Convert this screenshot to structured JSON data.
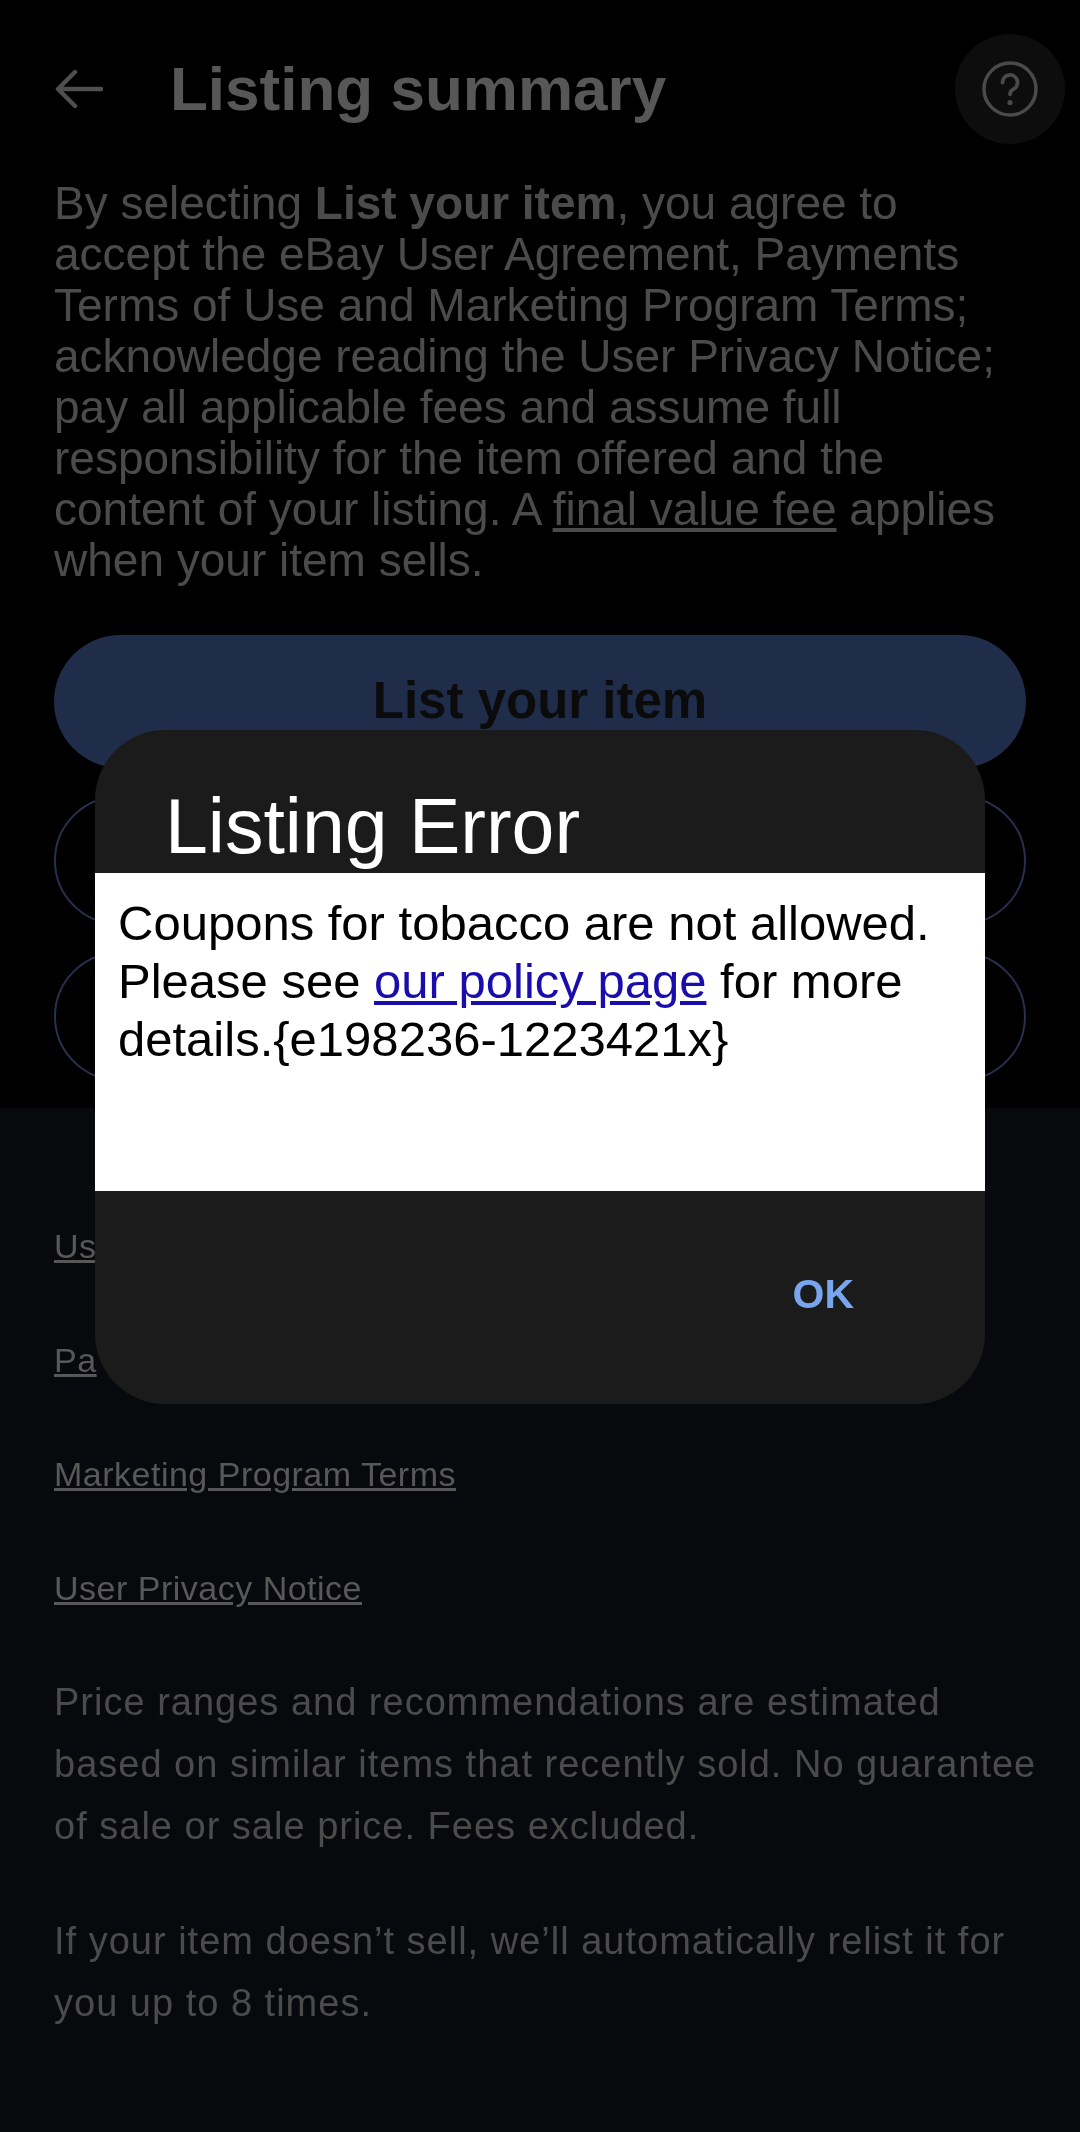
{
  "header": {
    "title": "Listing summary"
  },
  "agreement": {
    "text_before": "By selecting **List your item**, you agree to accept the eBay User Agreement, Payments Terms of Use and Marketing Program Terms; acknowledge reading the User Privacy Notice; pay all applicable fees and assume full responsibility for the item offered and the content of your listing. A",
    "link": "final value fee",
    "text_after": "applies when your item sells."
  },
  "primary_button": {
    "label": "List your item"
  },
  "legal_links": [
    "Us",
    "Pa",
    "Marketing Program Terms",
    "User Privacy Notice"
  ],
  "notes": [
    "Price ranges and recommendations are estimated based on similar items that recently sold. No guarantee of sale or sale price. Fees excluded.",
    "If your item doesn’t sell, we’ll automatically relist it for you up to 8 times."
  ],
  "dialog": {
    "title": "Listing Error",
    "message_before": "Coupons for tobacco are not allowed. Please see",
    "link": "our policy page",
    "message_after": "for more details.{e198236-1223421x}",
    "buttons": [
      "OK"
    ]
  }
}
